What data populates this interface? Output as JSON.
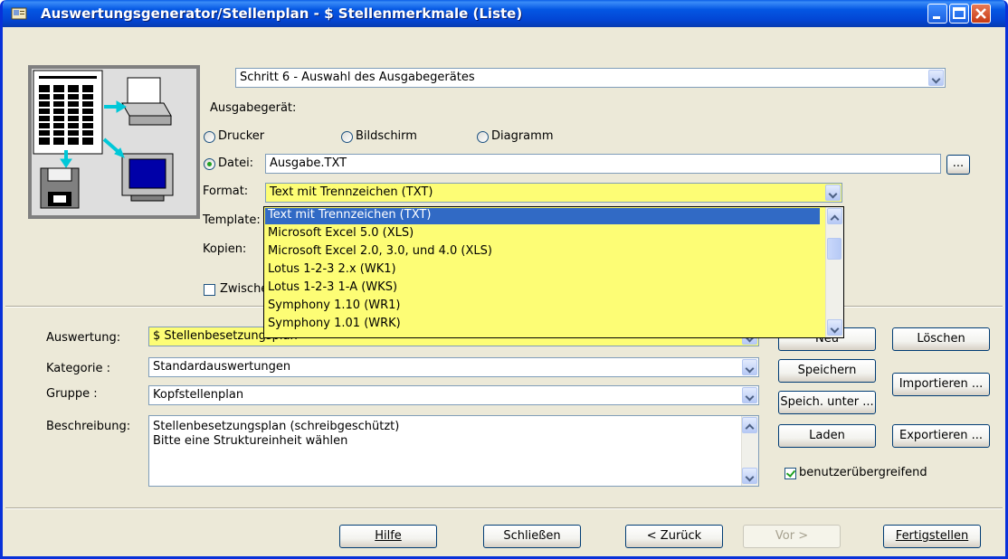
{
  "window": {
    "title": "Auswertungsgenerator/Stellenplan  -  $ Stellenmerkmale (Liste)"
  },
  "step": {
    "selected": "Schritt 6  -  Auswahl des Ausgabegerätes"
  },
  "output": {
    "heading": "Ausgabegerät:",
    "radios": [
      {
        "label": "Drucker",
        "selected": false
      },
      {
        "label": "Bildschirm",
        "selected": false
      },
      {
        "label": "Diagramm",
        "selected": false
      },
      {
        "label": "Datei:",
        "selected": true
      }
    ],
    "file_value": "Ausgabe.TXT",
    "browse_label": "...",
    "format_label": "Format:",
    "format_value": "Text mit Trennzeichen (TXT)",
    "template_label": "Template:",
    "copies_label": "Kopien:",
    "intermediate_label": "Zwische",
    "format_options": [
      "Text mit Trennzeichen (TXT)",
      "Microsoft Excel 5.0 (XLS)",
      "Microsoft Excel 2.0, 3.0, und 4.0 (XLS)",
      "Lotus 1-2-3 2.x (WK1)",
      "Lotus 1-2-3 1-A (WKS)",
      "Symphony 1.10 (WR1)",
      "Symphony 1.01 (WRK)"
    ]
  },
  "report": {
    "auswertung_label": "Auswertung:",
    "auswertung_value": "$ Stellenbesetzungsplan",
    "kategorie_label": "Kategorie :",
    "kategorie_value": "Standardauswertungen",
    "gruppe_label": "Gruppe :",
    "gruppe_value": "Kopfstellenplan",
    "beschreibung_label": "Beschreibung:",
    "beschreibung_line1": "Stellenbesetzungsplan (schreibgeschützt)",
    "beschreibung_line2": "Bitte eine Struktureinheit wählen",
    "cross_user_label": "benutzerübergreifend",
    "cross_user_checked": true
  },
  "side_buttons": {
    "neu": "Neu",
    "loeschen": "Löschen",
    "speichern": "Speichern",
    "importieren": "Importieren ...",
    "speich_unter": "Speich. unter ...",
    "laden": "Laden",
    "exportieren": "Exportieren ..."
  },
  "footer": {
    "hilfe": "Hilfe",
    "schliessen": "Schließen",
    "zurueck": "< Zurück",
    "vor": "Vor >",
    "fertig": "Fertigstellen"
  },
  "colors": {
    "titlebar": "#0457e3",
    "dialog_bg": "#ece9d8",
    "highlight_yellow": "#fdfd75",
    "selection": "#316ac5"
  }
}
